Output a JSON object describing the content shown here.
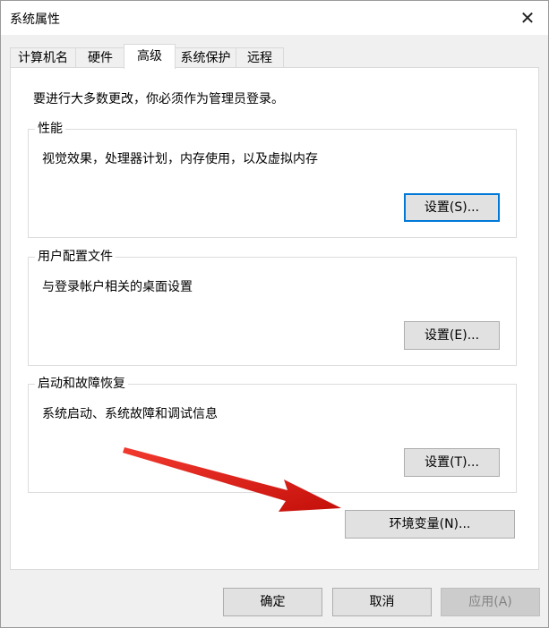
{
  "window": {
    "title": "系统属性",
    "close_glyph": "✕"
  },
  "tabs": [
    {
      "label": "计算机名"
    },
    {
      "label": "硬件"
    },
    {
      "label": "高级"
    },
    {
      "label": "系统保护"
    },
    {
      "label": "远程"
    }
  ],
  "active_tab": "高级",
  "advanced": {
    "admin_note": "要进行大多数更改，你必须作为管理员登录。",
    "performance": {
      "title": "性能",
      "description": "视觉效果，处理器计划，内存使用，以及虚拟内存",
      "settings_label": "设置(S)..."
    },
    "user_profiles": {
      "title": "用户配置文件",
      "description": "与登录帐户相关的桌面设置",
      "settings_label": "设置(E)..."
    },
    "startup_recovery": {
      "title": "启动和故障恢复",
      "description": "系统启动、系统故障和调试信息",
      "settings_label": "设置(T)..."
    },
    "env_vars_label": "环境变量(N)..."
  },
  "footer": {
    "ok_label": "确定",
    "cancel_label": "取消",
    "apply_label": "应用(A)"
  },
  "colors": {
    "focus_border": "#0078d7",
    "annotation_arrow": "#e8201a"
  }
}
